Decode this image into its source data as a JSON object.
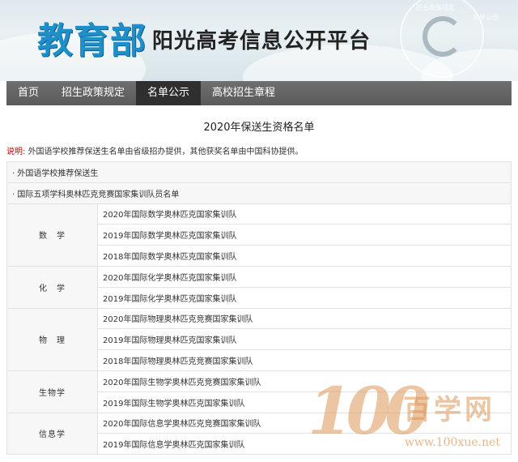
{
  "banner": {
    "title_main": "教育部",
    "title_sub": "阳光高考信息公开平台",
    "emblem_text_1": "招生政策规定",
    "emblem_text_2": "名单公示"
  },
  "nav": {
    "items": [
      {
        "label": "首页"
      },
      {
        "label": "招生政策规定"
      },
      {
        "label": "名单公示",
        "active": true
      },
      {
        "label": "高校招生章程"
      }
    ]
  },
  "page": {
    "title": "2020年保送生资格名单",
    "note_label": "说明:",
    "note_text": "外国语学校推荐保送生名单由省级招办提供，其他获奖名单由中国科协提供。"
  },
  "sections": {
    "foreign_language": "· 外国语学校推荐保送生",
    "olympiad": "· 国际五项学科奥林匹克竞赛国家集训队员名单"
  },
  "subjects": [
    {
      "name": "数　学",
      "items": [
        "2020年国际数学奥林匹克国家集训队",
        "2019年国际数学奥林匹克国家集训队",
        "2018年国际数学奥林匹克国家集训队"
      ]
    },
    {
      "name": "化　学",
      "items": [
        "2020年国际化学奥林匹克国家集训队",
        "2019年国际化学奥林匹克国家集训队"
      ]
    },
    {
      "name": "物　理",
      "items": [
        "2020年国际物理奥林匹克竞赛国家集训队",
        "2019年国际物理奥林匹克国家集训队",
        "2018年国际物理奥林匹克竞赛国家集训队"
      ]
    },
    {
      "name": "生物学",
      "items": [
        "2020年国际生物学奥林匹克竞赛国家集训队",
        "2019年国际生物学奥林匹克国家集训队"
      ]
    },
    {
      "name": "信息学",
      "items": [
        "2020年国际信息学奥林匹克竞赛国家集训队",
        "2019年国际信息学奥林匹克国家集训队"
      ]
    }
  ],
  "watermark": {
    "number": "100",
    "name": "百学网",
    "url": "www.100xue.net"
  }
}
